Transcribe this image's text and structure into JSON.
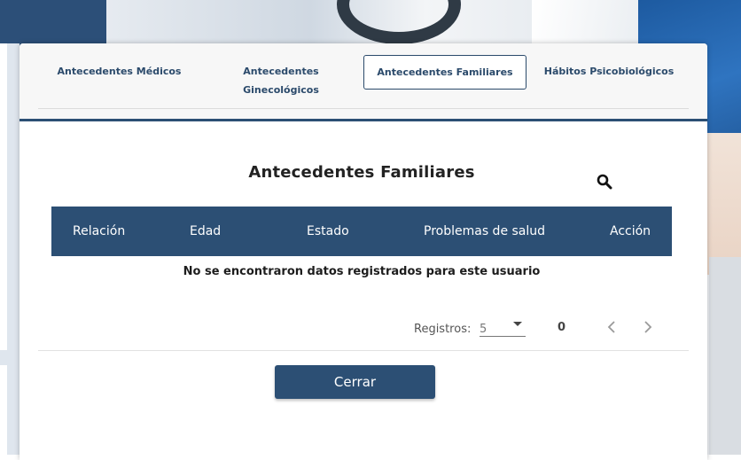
{
  "tabs": [
    {
      "label": "Antecedentes Médicos"
    },
    {
      "label_line1": "Antecedentes",
      "label_line2": "Ginecológicos"
    },
    {
      "label": "Antecedentes Familiares",
      "active": true
    },
    {
      "label": "Hábitos Psicobiológicos"
    }
  ],
  "section": {
    "title": "Antecedentes Familiares",
    "search_icon": "search-icon"
  },
  "table": {
    "columns": [
      "Relación",
      "Edad",
      "Estado",
      "Problemas de salud",
      "Acción"
    ],
    "rows": [],
    "empty_message": "No se encontraron datos registrados para este usuario"
  },
  "pagination": {
    "label": "Registros:",
    "page_size": "5",
    "count": "0",
    "prev_icon": "chevron-left-icon",
    "next_icon": "chevron-right-icon"
  },
  "footer": {
    "close_label": "Cerrar"
  },
  "colors": {
    "primary": "#2c4f74",
    "tab_text": "#2b4a6b",
    "header_text": "#ffffff"
  }
}
